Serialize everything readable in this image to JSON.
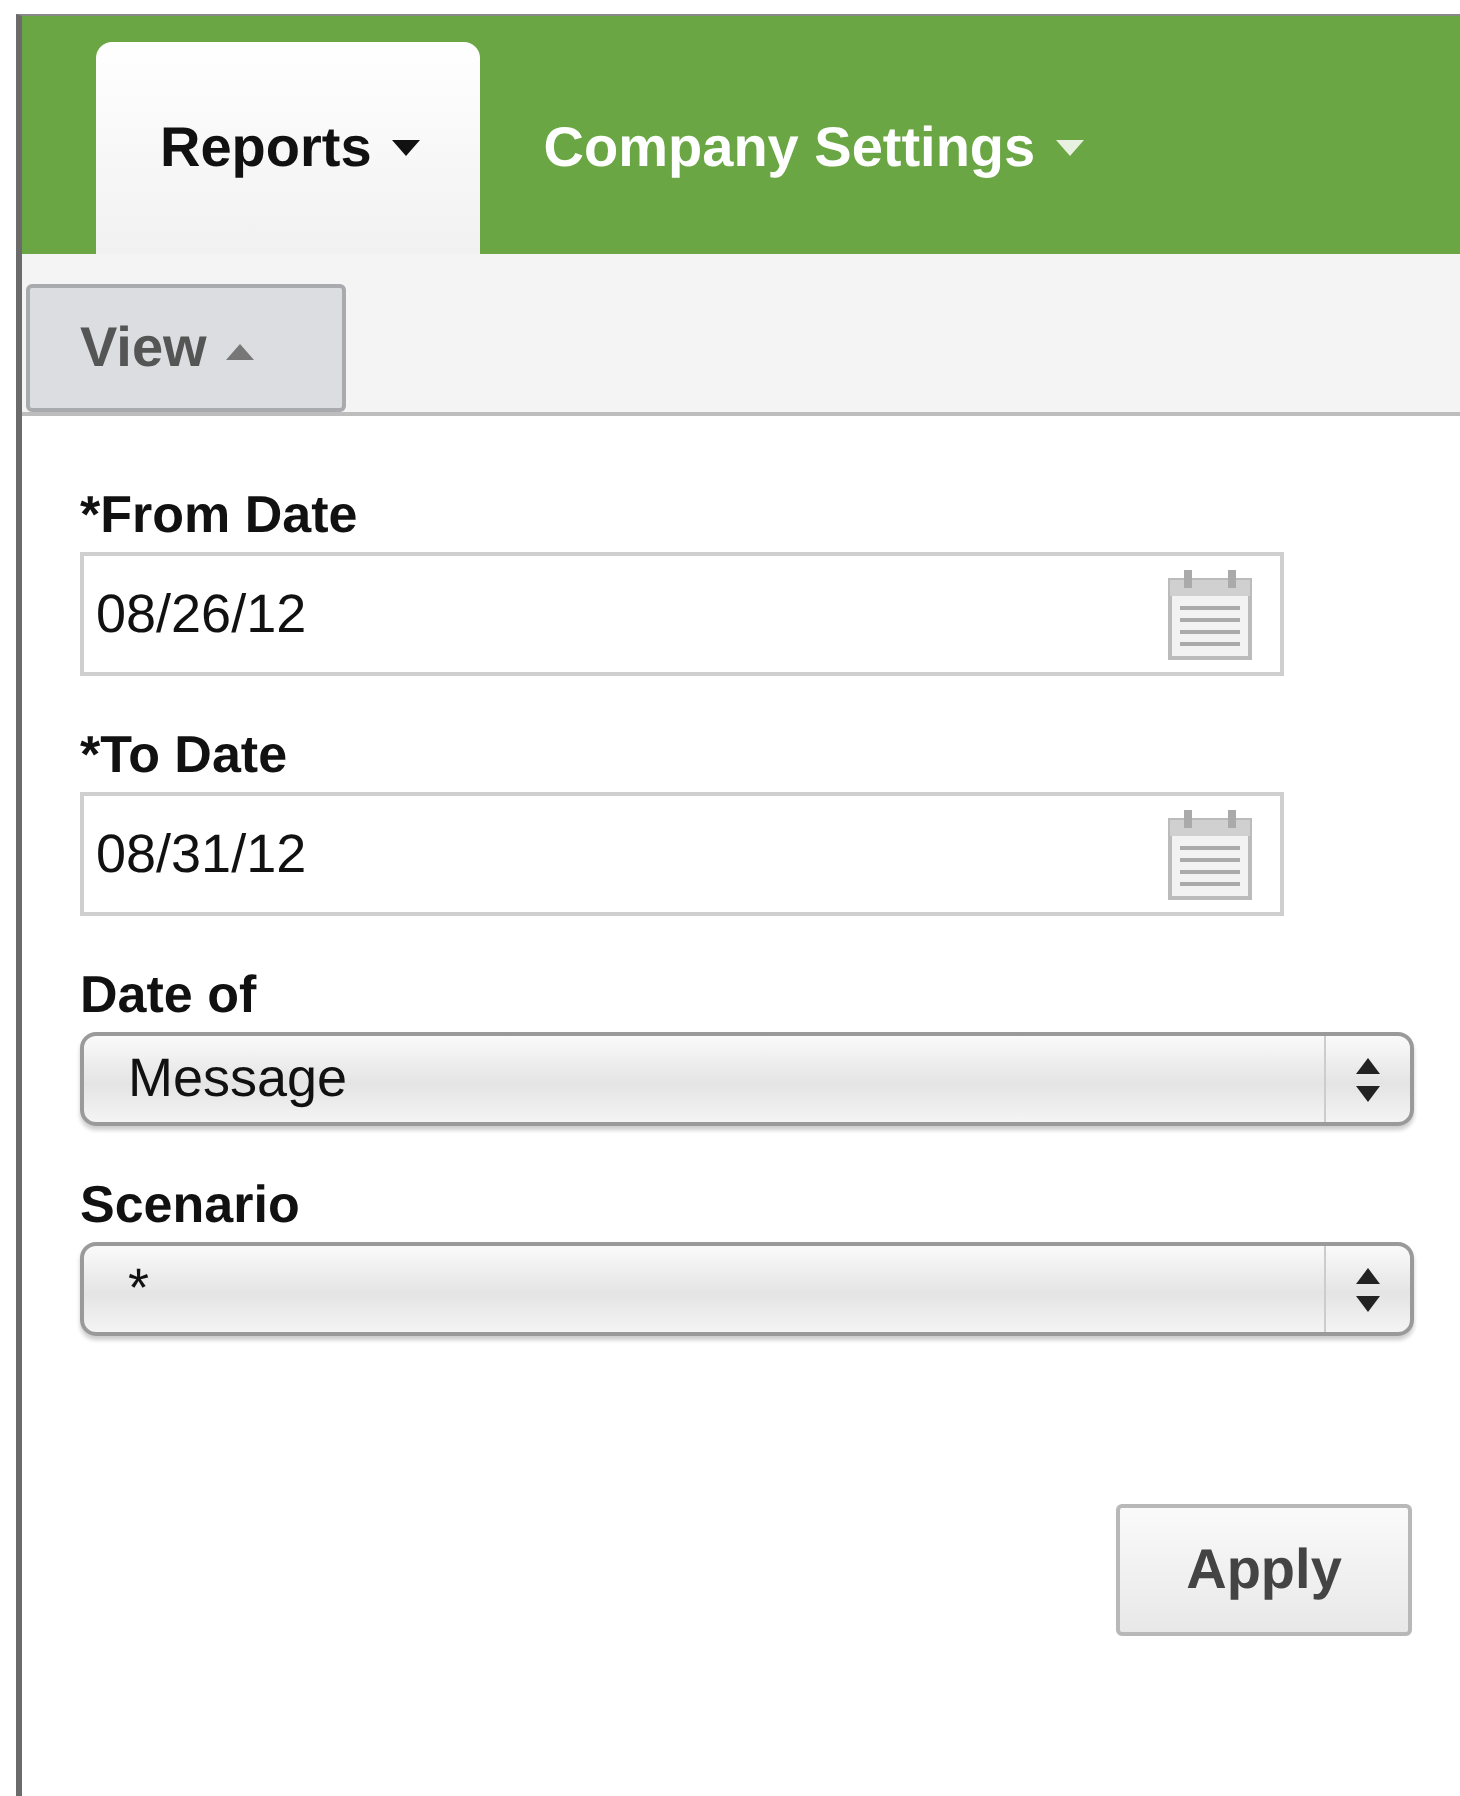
{
  "tabs": [
    {
      "label": "Reports",
      "selected": true
    },
    {
      "label": "Company Settings",
      "selected": false
    }
  ],
  "toolbar": {
    "button": {
      "label": "View",
      "expanded": true
    }
  },
  "fields": [
    {
      "kind": "date",
      "label": "*From Date",
      "value": "08/26/12"
    },
    {
      "kind": "date",
      "label": "*To Date",
      "value": "08/31/12"
    },
    {
      "kind": "select",
      "label": "Date of",
      "value": "Message"
    },
    {
      "kind": "select",
      "label": "Scenario",
      "value": "*"
    }
  ],
  "apply_button": {
    "label": "Apply"
  }
}
